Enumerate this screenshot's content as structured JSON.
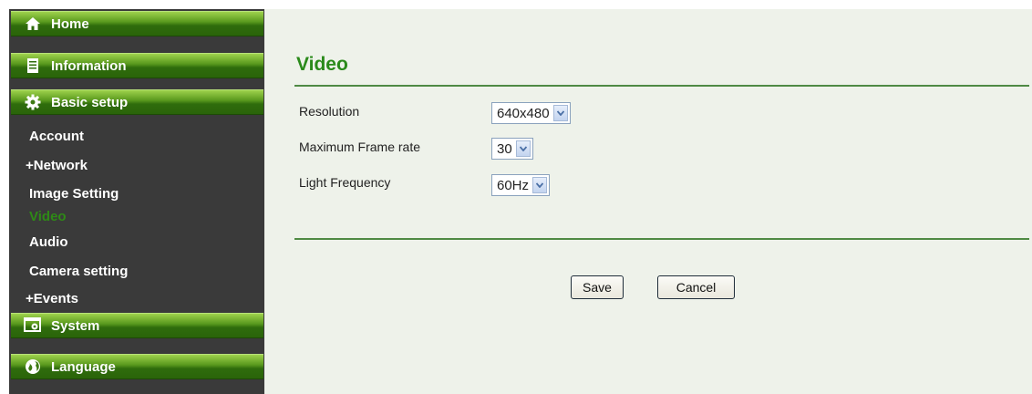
{
  "sidebar": {
    "top_buttons": [
      {
        "label": "Home",
        "icon": "home-icon"
      },
      {
        "label": "Information",
        "icon": "document-icon"
      },
      {
        "label": "Basic setup",
        "icon": "gear-icon"
      }
    ],
    "sub_items": [
      {
        "label": "Account",
        "active": false
      },
      {
        "label": "+Network",
        "active": false
      },
      {
        "label": "Image Setting",
        "active": false
      },
      {
        "label": "Video",
        "active": true
      },
      {
        "label": "Audio",
        "active": false
      },
      {
        "label": "Camera setting",
        "active": false
      },
      {
        "label": "+Events",
        "active": false
      }
    ],
    "bottom_buttons": [
      {
        "label": "System",
        "icon": "system-icon"
      },
      {
        "label": "Language",
        "icon": "globe-icon"
      }
    ]
  },
  "main": {
    "title": "Video",
    "fields": [
      {
        "label": "Resolution",
        "value": "640x480"
      },
      {
        "label": "Maximum Frame rate",
        "value": "30"
      },
      {
        "label": "Light Frequency",
        "value": "60Hz"
      }
    ],
    "save_label": "Save",
    "cancel_label": "Cancel"
  },
  "colors": {
    "accent_green": "#2a8a1a",
    "active_item": "#2e8a16",
    "sidebar_bg": "#3a3a3a",
    "content_bg": "#eef2ea"
  }
}
